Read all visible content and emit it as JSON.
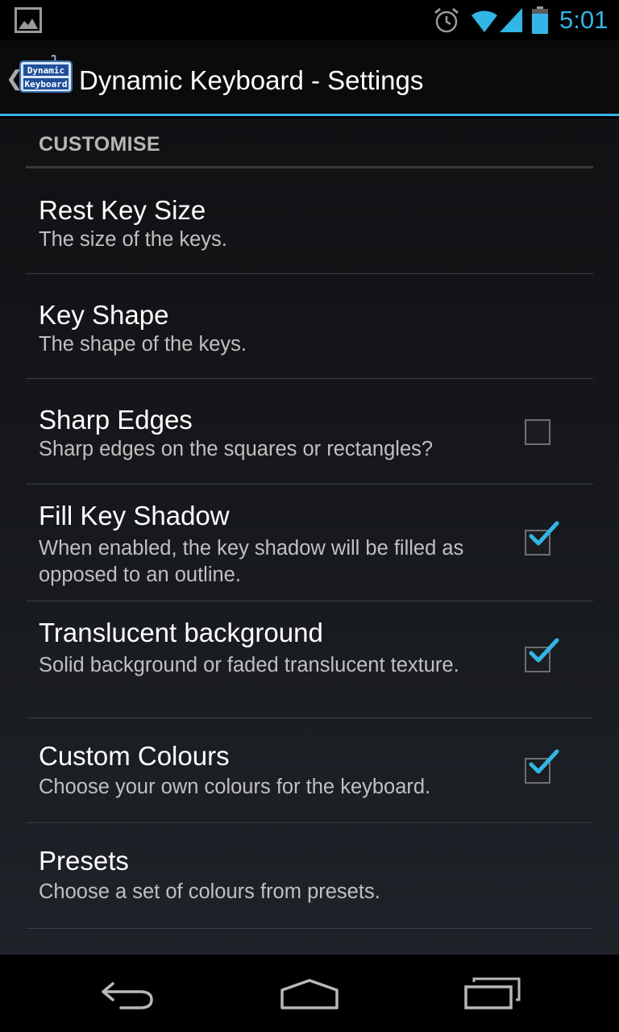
{
  "status_bar": {
    "time": "5:01",
    "accent_color": "#33b5e5",
    "icons": [
      "gallery-icon",
      "alarm-icon",
      "wifi-icon",
      "signal-icon",
      "battery-icon"
    ]
  },
  "action_bar": {
    "title": "Dynamic Keyboard - Settings",
    "app_icon_text_line1": "Dynamic",
    "app_icon_text_line2": "Keyboard",
    "up_caret": "❮"
  },
  "section": {
    "header": "CUSTOMISE"
  },
  "preferences": [
    {
      "title": "Rest Key Size",
      "summary": "The size of the keys.",
      "checkbox": null
    },
    {
      "title": "Key Shape",
      "summary": "The shape of the keys.",
      "checkbox": null
    },
    {
      "title": "Sharp Edges",
      "summary": "Sharp edges on the squares or rectangles?",
      "checkbox": false
    },
    {
      "title": "Fill Key Shadow",
      "summary": "When enabled, the key shadow will be filled as opposed to an outline.",
      "checkbox": true
    },
    {
      "title": "Translucent background",
      "summary": "Solid background or faded translucent texture.",
      "checkbox": true
    },
    {
      "title": "Custom Colours",
      "summary": "Choose your own colours for the keyboard.",
      "checkbox": true
    },
    {
      "title": "Presets",
      "summary": "Choose a set of colours from presets.",
      "checkbox": null
    }
  ],
  "nav_bar": {
    "icons": [
      "back-icon",
      "home-icon",
      "recents-icon"
    ]
  }
}
